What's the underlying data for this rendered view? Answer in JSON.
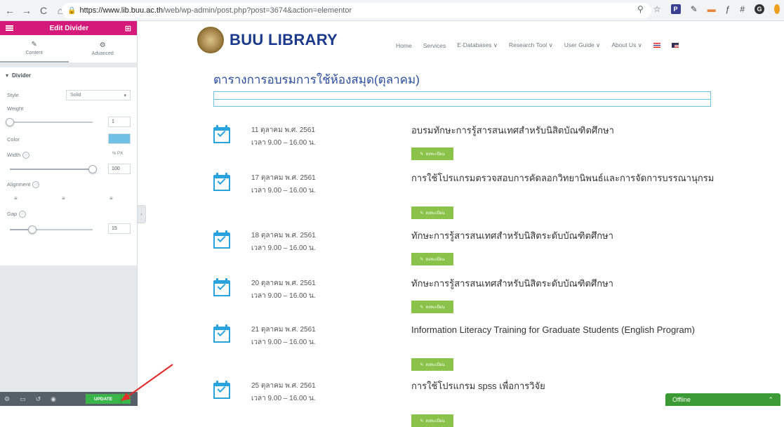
{
  "browser": {
    "url_host": "https://www.lib.buu.ac.th",
    "url_path": "/web/wp-admin/post.php?post=3674&action=elementor",
    "nav_icons": [
      "back-icon",
      "forward-icon",
      "reload-icon",
      "home-icon"
    ]
  },
  "panel": {
    "title": "Edit Divider",
    "tabs": [
      {
        "label": "Content",
        "icon": "pencil-icon"
      },
      {
        "label": "Advanced",
        "icon": "gear-icon"
      }
    ],
    "section": "Divider",
    "style_label": "Style",
    "style_value": "Solid",
    "weight_label": "Weight",
    "weight_value": "1",
    "color_label": "Color",
    "color_value": "#6ec1e4",
    "width_label": "Width",
    "width_unit": "% PX",
    "width_value": "100",
    "alignment_label": "Alignment",
    "gap_label": "Gap",
    "gap_value": "15",
    "footer_update": "UPDATE"
  },
  "site": {
    "brand": "BUU LIBRARY",
    "nav": [
      "Home",
      "Services",
      "E-Databases ∨",
      "Research Tool ∨",
      "User Guide ∨",
      "About Us ∨"
    ],
    "page_title": "ตารางการอบรมการใช้ห้องสมุด(ตุลาคม)",
    "register_label": "ลงทะเบียน",
    "events": [
      {
        "date": "11 ตุลาคม พ.ศ. 2561",
        "time": "เวลา 9.00 – 16.00 น.",
        "title": "อบรมทักษะการรู้สารสนเทศสำหรับนิสิตบัณฑิตศึกษา"
      },
      {
        "date": "17 ตุลาคม พ.ศ. 2561",
        "time": "เวลา 9.00 – 16.00 น.",
        "title": "การใช้โปรแกรมตรวจสอบการคัดลอกวิทยานิพนธ์และการจัดการบรรณานุกรม"
      },
      {
        "date": "18 ตุลาคม พ.ศ. 2561",
        "time": "เวลา 9.00 – 16.00 น.",
        "title": "ทักษะการรู้สารสนเทศสำหรับนิสิตระดับบัณฑิตศึกษา"
      },
      {
        "date": "20 ตุลาคม พ.ศ. 2561",
        "time": "เวลา 9.00 – 16.00 น.",
        "title": "ทักษะการรู้สารสนเทศสำหรับนิสิตระดับบัณฑิตศึกษา"
      },
      {
        "date": "21 ตุลาคม พ.ศ. 2561",
        "time": "เวลา 9.00 – 16.00 น.",
        "title": "Information Literacy Training for Graduate Students (English Program)"
      },
      {
        "date": "25 ตุลาคม พ.ศ. 2561",
        "time": "เวลา 9.00 – 16.00 น.",
        "title": "การใช้โปรแกรม spss เพื่อการวิจัย"
      }
    ]
  },
  "chat": {
    "label": "Offline"
  },
  "colors": {
    "panel_header": "#d5197a",
    "update_button": "#39b54a",
    "divider": "#6ec1e4",
    "register_button": "#8bc34a",
    "annotation_arrow": "#e32b2b"
  }
}
